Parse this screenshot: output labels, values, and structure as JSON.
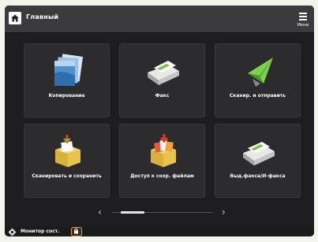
{
  "header": {
    "title": "Главный",
    "menu_label": "Меню"
  },
  "tiles": [
    {
      "label": "Копирование",
      "icon": "copy-icon"
    },
    {
      "label": "Факс",
      "icon": "fax-icon"
    },
    {
      "label": "Сканир. и отправить",
      "icon": "scan-send-icon"
    },
    {
      "label": "Сканировать и сохранить",
      "icon": "scan-store-icon"
    },
    {
      "label": "Доступ к сохр. файлам",
      "icon": "stored-files-icon"
    },
    {
      "label": "Выд.факса/И-факса",
      "icon": "fax-tx-icon"
    }
  ],
  "pager": {
    "prev": "‹",
    "next": "›"
  },
  "footer": {
    "status_label": "Монитор сост."
  },
  "colors": {
    "background": "#f3f5ec",
    "screen": "#1e1e20",
    "tile": "#2c2c2e",
    "accent": "#f0a020"
  }
}
